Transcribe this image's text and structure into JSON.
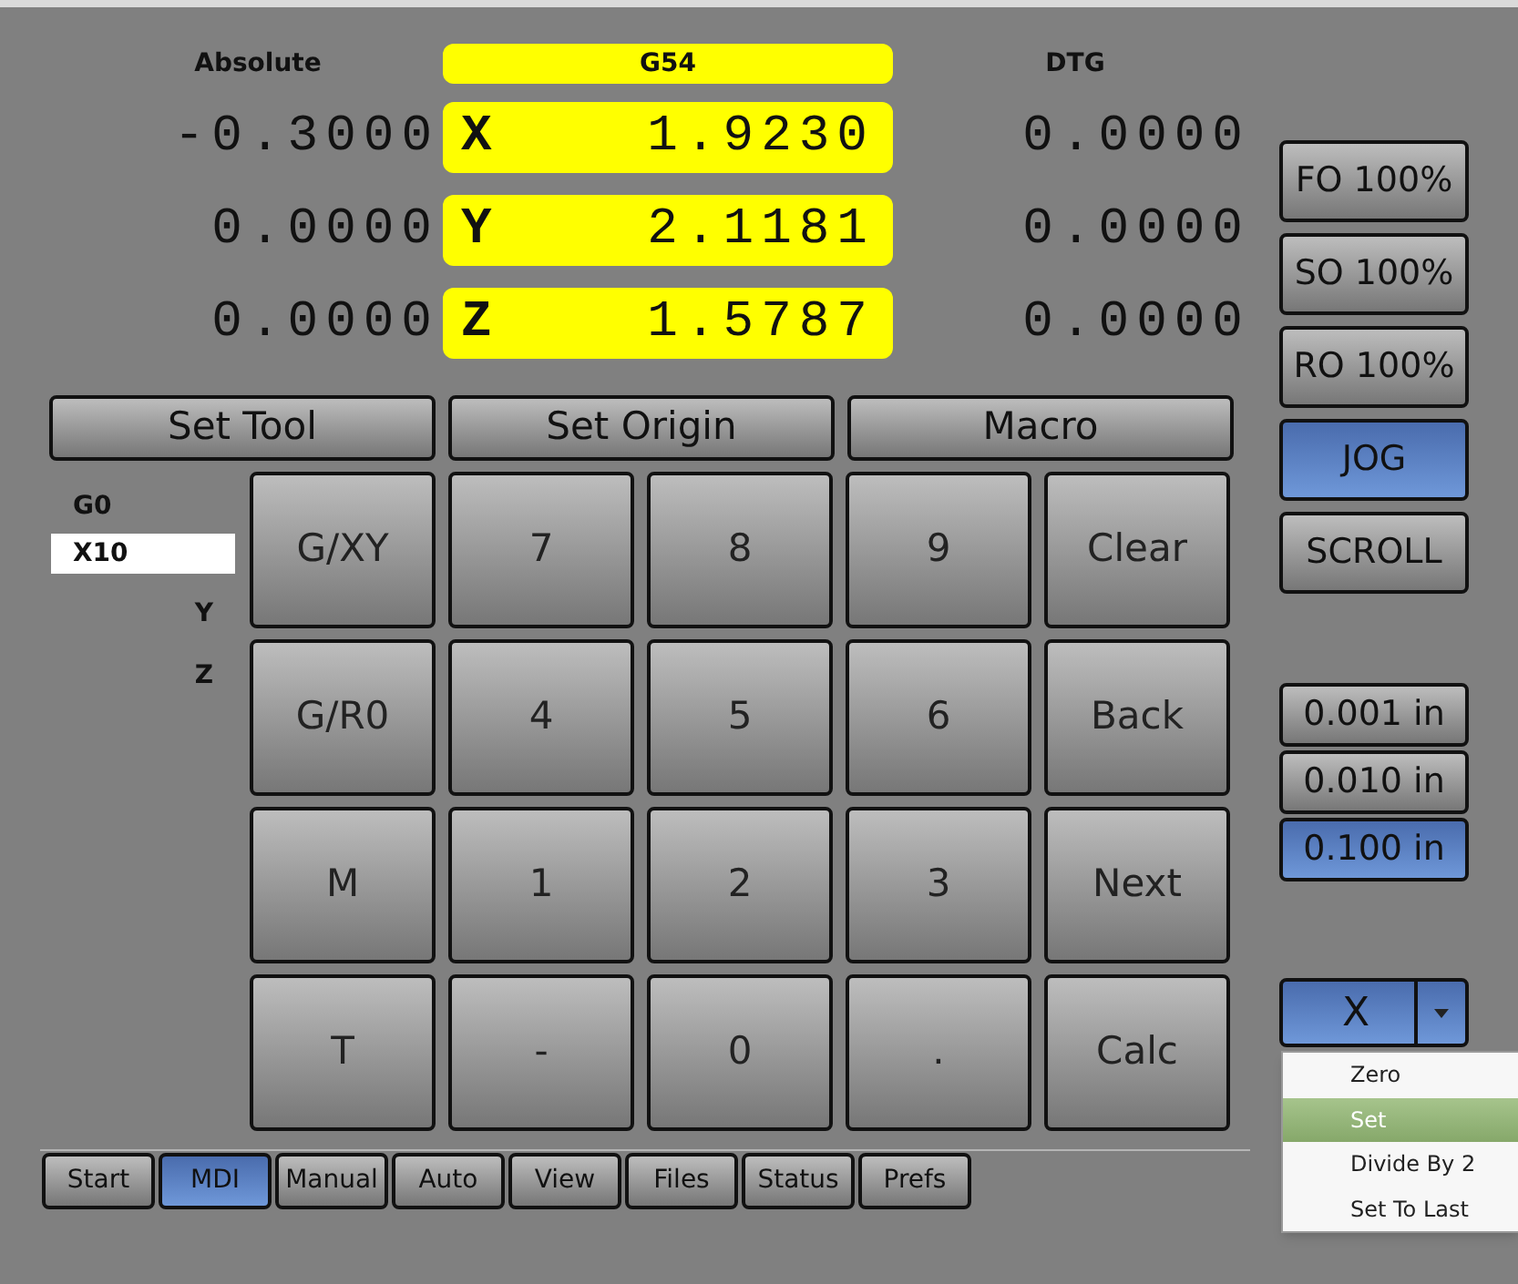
{
  "header": {
    "absolute_label": "Absolute",
    "offset_label": "G54",
    "dtg_label": "DTG"
  },
  "axes": [
    {
      "absolute": "-0.3000",
      "axis": "X",
      "work": "1.9230",
      "dtg": "0.0000"
    },
    {
      "absolute": "0.0000",
      "axis": "Y",
      "work": "2.1181",
      "dtg": "0.0000"
    },
    {
      "absolute": "0.0000",
      "axis": "Z",
      "work": "1.5787",
      "dtg": "0.0000"
    }
  ],
  "action_buttons": [
    "Set Tool",
    "Set Origin",
    "Macro"
  ],
  "gcode_status": [
    {
      "text": "G0",
      "kind": "modal"
    },
    {
      "text": "X10",
      "kind": "input"
    },
    {
      "text": "Y",
      "kind": "axis"
    },
    {
      "text": "Z",
      "kind": "axis"
    }
  ],
  "keypad": [
    [
      "G/XY",
      "7",
      "8",
      "9",
      "Clear"
    ],
    [
      "G/R0",
      "4",
      "5",
      "6",
      "Back"
    ],
    [
      "M",
      "1",
      "2",
      "3",
      "Next"
    ],
    [
      "T",
      "-",
      "0",
      ".",
      "Calc"
    ]
  ],
  "overrides": [
    {
      "label": "FO 100%",
      "selected": false
    },
    {
      "label": "SO 100%",
      "selected": false
    },
    {
      "label": "RO 100%",
      "selected": false
    },
    {
      "label": "JOG",
      "selected": true
    },
    {
      "label": "SCROLL",
      "selected": false
    }
  ],
  "increments": [
    {
      "label": "0.001 in",
      "selected": false
    },
    {
      "label": "0.010 in",
      "selected": false
    },
    {
      "label": "0.100 in",
      "selected": true
    }
  ],
  "axis_select": {
    "value": "X",
    "menu": [
      {
        "label": "Zero",
        "selected": false
      },
      {
        "label": "Set",
        "selected": true
      },
      {
        "label": "Divide By 2",
        "selected": false
      },
      {
        "label": "Set To Last",
        "selected": false
      }
    ]
  },
  "tabs": [
    {
      "label": "Start",
      "selected": false
    },
    {
      "label": "MDI",
      "selected": true
    },
    {
      "label": "Manual",
      "selected": false
    },
    {
      "label": "Auto",
      "selected": false
    },
    {
      "label": "View",
      "selected": false
    },
    {
      "label": "Files",
      "selected": false
    },
    {
      "label": "Status",
      "selected": false
    },
    {
      "label": "Prefs",
      "selected": false
    }
  ]
}
